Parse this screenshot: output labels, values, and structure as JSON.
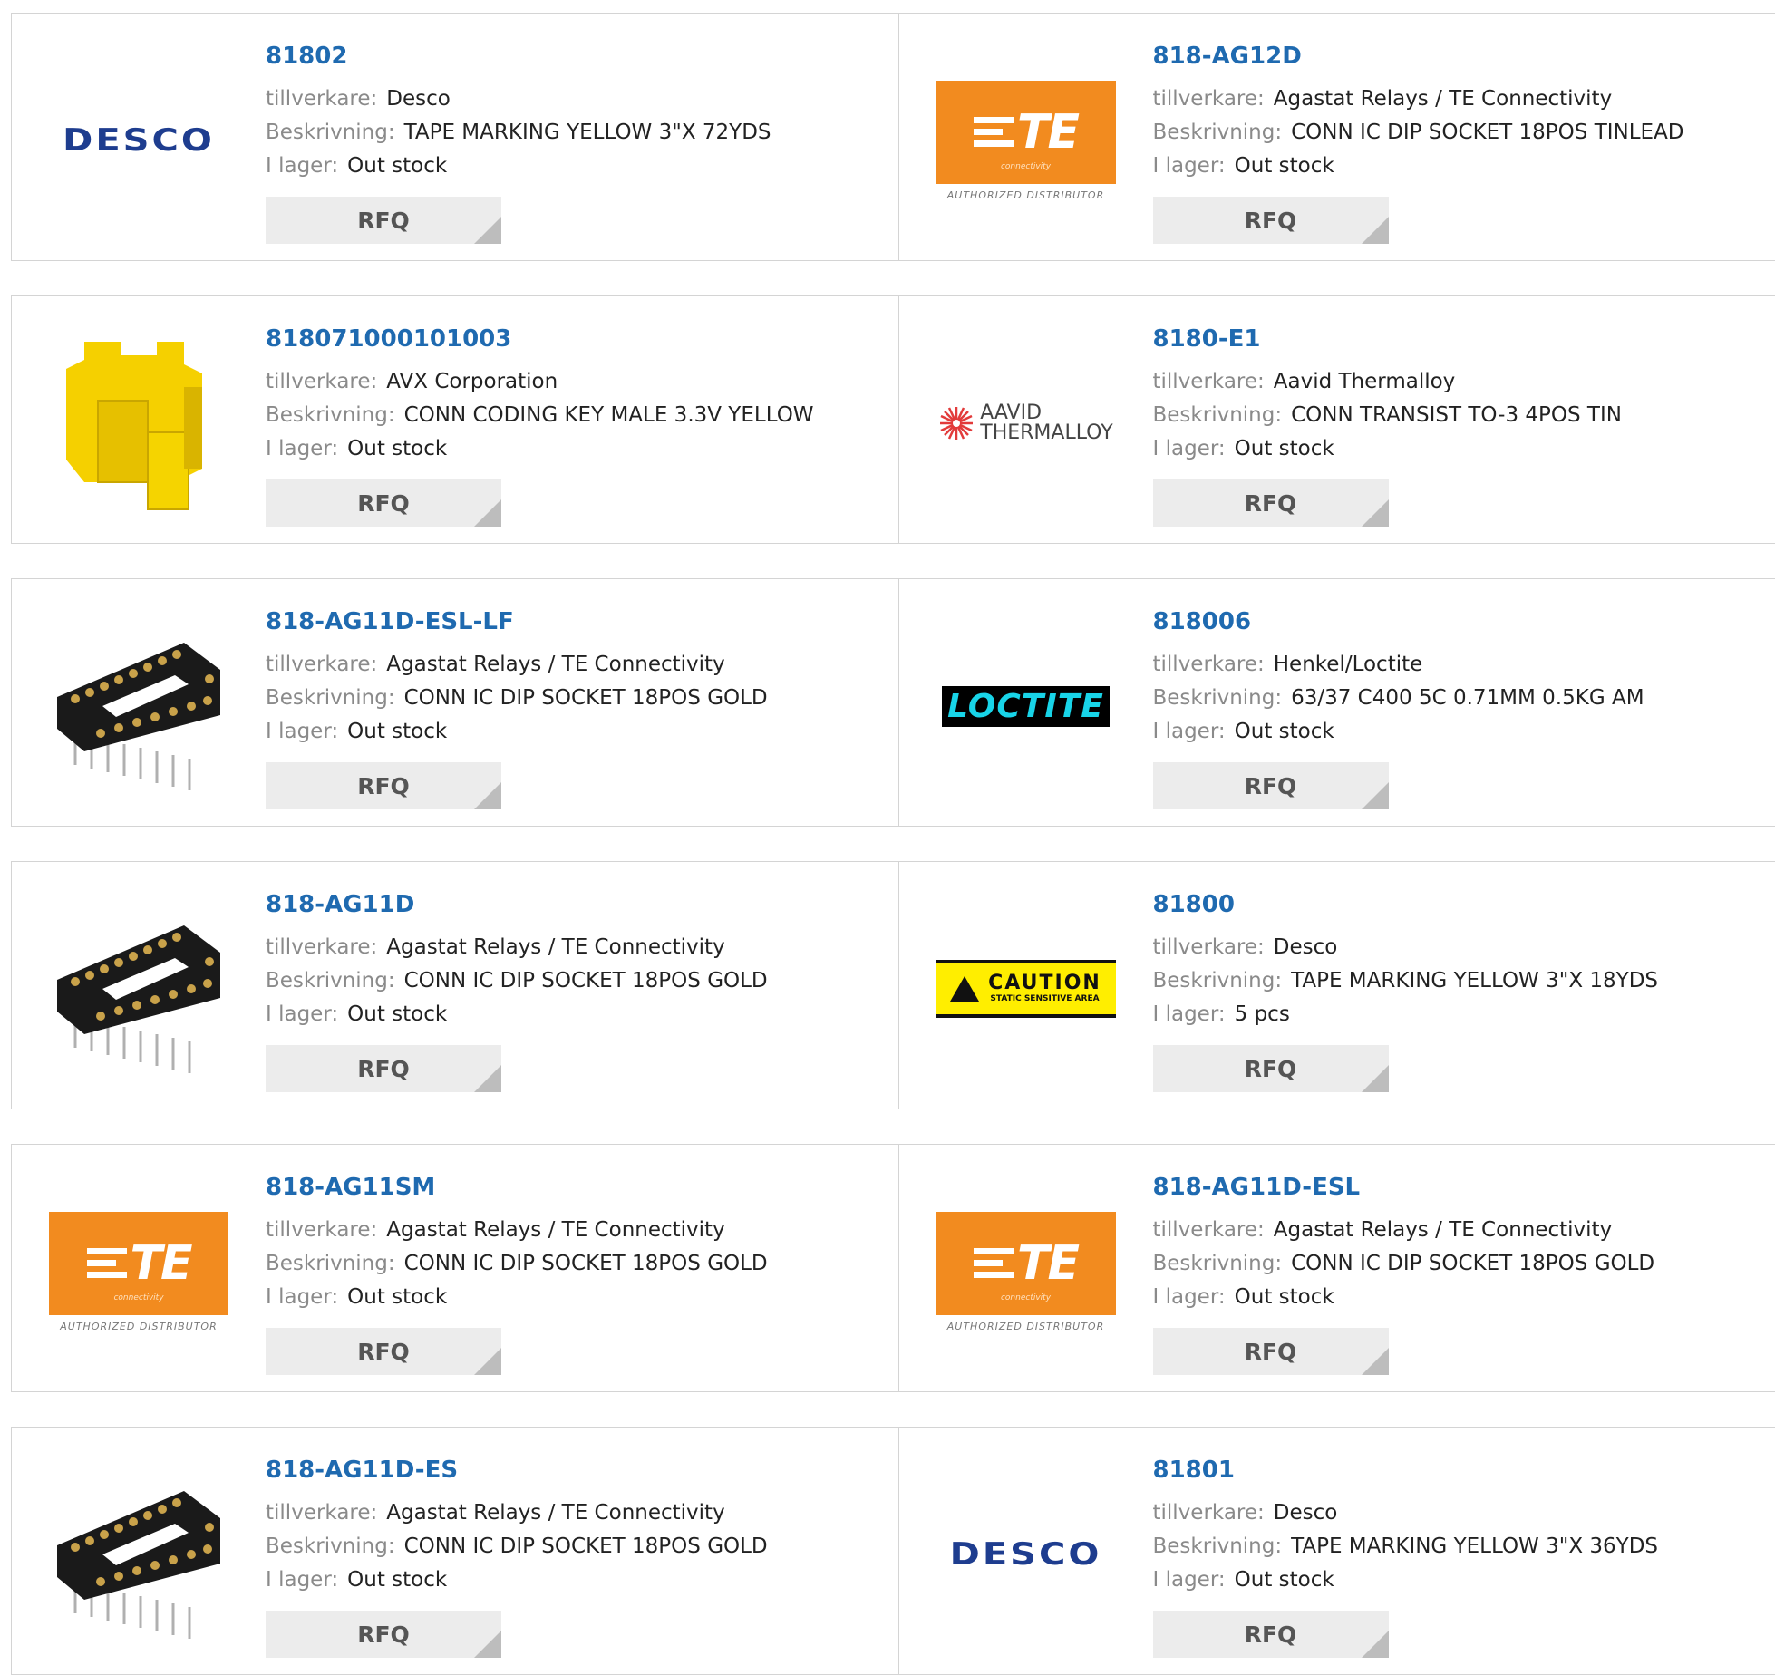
{
  "labels": {
    "manufacturer": "tillverkare:",
    "description": "Beskrivning:",
    "stock": "I lager:",
    "rfq": "RFQ"
  },
  "logos": {
    "desco": "DESCO",
    "te": "TE",
    "te_sub": "connectivity",
    "te_authorized": "AUTHORIZED DISTRIBUTOR",
    "aavid_1": "AAVID",
    "aavid_2": "THERMALLOY",
    "loctite": "LOCTITE",
    "caution_big": "CAUTION",
    "caution_small": "STATIC SENSITIVE AREA"
  },
  "products": [
    {
      "part": "81802",
      "manufacturer": "Desco",
      "description": "TAPE MARKING YELLOW 3\"X 72YDS",
      "stock": "Out stock",
      "image": "desco-logo"
    },
    {
      "part": "818-AG12D",
      "manufacturer": "Agastat Relays / TE Connectivity",
      "description": "CONN IC DIP SOCKET 18POS TINLEAD",
      "stock": "Out stock",
      "image": "te-connectivity-logo"
    },
    {
      "part": "818071000101003",
      "manufacturer": "AVX Corporation",
      "description": "CONN CODING KEY MALE 3.3V YELLOW",
      "stock": "Out stock",
      "image": "yellow-coding-key-photo"
    },
    {
      "part": "8180-E1",
      "manufacturer": "Aavid Thermalloy",
      "description": "CONN TRANSIST TO-3 4POS TIN",
      "stock": "Out stock",
      "image": "aavid-thermalloy-logo"
    },
    {
      "part": "818-AG11D-ESL-LF",
      "manufacturer": "Agastat Relays / TE Connectivity",
      "description": "CONN IC DIP SOCKET 18POS GOLD",
      "stock": "Out stock",
      "image": "dip-socket-photo"
    },
    {
      "part": "818006",
      "manufacturer": "Henkel/Loctite",
      "description": "63/37 C400 5C 0.71MM 0.5KG AM",
      "stock": "Out stock",
      "image": "loctite-logo"
    },
    {
      "part": "818-AG11D",
      "manufacturer": "Agastat Relays / TE Connectivity",
      "description": "CONN IC DIP SOCKET 18POS GOLD",
      "stock": "Out stock",
      "image": "dip-socket-photo"
    },
    {
      "part": "81800",
      "manufacturer": "Desco",
      "description": "TAPE MARKING YELLOW 3\"X 18YDS",
      "stock": "5 pcs",
      "image": "caution-tape-photo"
    },
    {
      "part": "818-AG11SM",
      "manufacturer": "Agastat Relays / TE Connectivity",
      "description": "CONN IC DIP SOCKET 18POS GOLD",
      "stock": "Out stock",
      "image": "te-connectivity-logo"
    },
    {
      "part": "818-AG11D-ESL",
      "manufacturer": "Agastat Relays / TE Connectivity",
      "description": "CONN IC DIP SOCKET 18POS GOLD",
      "stock": "Out stock",
      "image": "te-connectivity-logo"
    },
    {
      "part": "818-AG11D-ES",
      "manufacturer": "Agastat Relays / TE Connectivity",
      "description": "CONN IC DIP SOCKET 18POS GOLD",
      "stock": "Out stock",
      "image": "dip-socket-photo"
    },
    {
      "part": "81801",
      "manufacturer": "Desco",
      "description": "TAPE MARKING YELLOW 3\"X 36YDS",
      "stock": "Out stock",
      "image": "desco-logo"
    }
  ],
  "colors": {
    "link": "#1f6ab0",
    "label": "#8a8a8a",
    "rfq_bg": "#ececec",
    "te_orange": "#f28b1f",
    "desco_blue": "#1e3d8f"
  }
}
